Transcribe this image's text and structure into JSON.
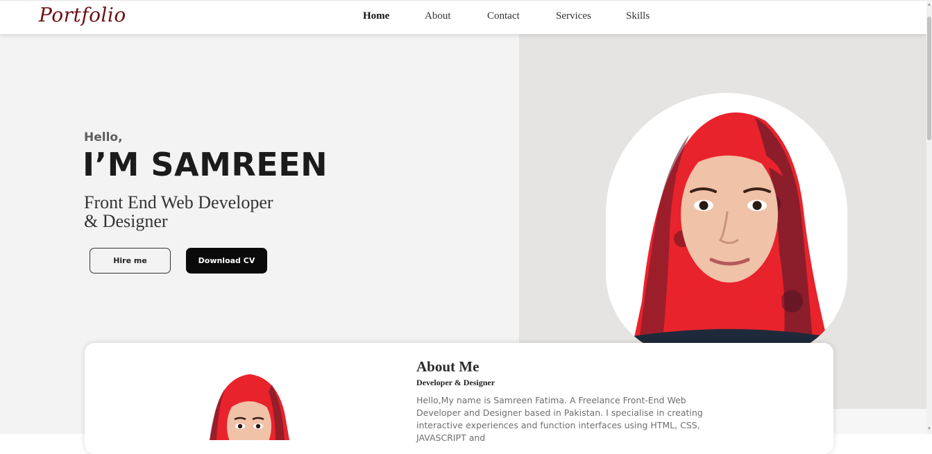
{
  "nav": {
    "logo": "Portfolio",
    "links": [
      {
        "label": "Home",
        "active": true
      },
      {
        "label": "About",
        "active": false
      },
      {
        "label": "Contact",
        "active": false
      },
      {
        "label": "Services",
        "active": false
      },
      {
        "label": "Skills",
        "active": false
      }
    ]
  },
  "hero": {
    "greeting": "Hello,",
    "name": "I’M SAMREEN",
    "role_line1": "Front End Web Developer",
    "role_line2": "& Designer",
    "buttons": {
      "hire": "Hire me",
      "download_cv": "Download CV"
    },
    "portrait_icon": "profile-photo"
  },
  "about": {
    "title": "About Me",
    "subtitle": "Developer & Designer",
    "text": "Hello,My name is Samreen Fatima. A Freelance Front-End Web Developer and Designer based in Pakistan. I specialise in creating interactive experiences and function interfaces using HTML, CSS, JAVASCRIPT and"
  },
  "colors": {
    "logo": "#6b1014",
    "hero_left_bg": "#f3f3f3",
    "hero_right_bg": "#e5e4e2",
    "primary_button": "#0a0a0a",
    "scarf": "#e8232c"
  }
}
